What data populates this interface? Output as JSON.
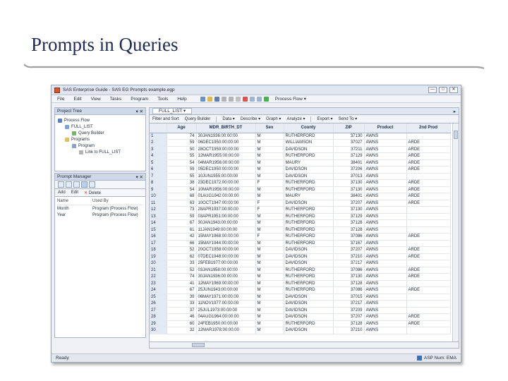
{
  "slide": {
    "title": "Prompts in Queries"
  },
  "window": {
    "title": "SAS Enterprise Guide - SAS EG Prompts example.egp",
    "buttons": [
      "—",
      "□",
      "✕"
    ]
  },
  "menu": [
    "File",
    "Edit",
    "View",
    "Tasks",
    "Program",
    "Tools",
    "Help"
  ],
  "toolbar": {
    "process_flow": "Process Flow ▾"
  },
  "project_tree": {
    "header": "Project Tree",
    "close": "▾ ✕",
    "items": [
      "Process Flow",
      "FULL_LIST",
      "Query Builder",
      "Programs",
      "Program",
      "Link to FULL_LIST"
    ]
  },
  "prompt_manager": {
    "header": "Prompt Manager",
    "close": "▾ ✕",
    "actions": [
      "Add",
      "Edit",
      "Delete"
    ],
    "columns": [
      "Name",
      "Used By"
    ],
    "rows": [
      {
        "name": "Month",
        "used_by": "Program (Process Flow)"
      },
      {
        "name": "Year",
        "used_by": "Program (Process Flow)"
      }
    ]
  },
  "data_view": {
    "tab": "FULL_LIST ▾",
    "tools": [
      "Filter and Sort",
      "Query Builder",
      "Data ▾",
      "Describe ▾",
      "Graph ▾",
      "Analyze ▾",
      "Export ▾",
      "Send To ▾"
    ],
    "columns": [
      "Age",
      "MDR_BIRTH_DT",
      "Sex",
      "County",
      "ZIP",
      "Product",
      "2nd Prod"
    ],
    "rows": [
      [
        "1",
        "74",
        "30JAN1936:00:00:00",
        "M",
        "RUTHERFORD",
        "37130",
        "AWNS",
        ""
      ],
      [
        "2",
        "59",
        "06DEC1950:00:00:00",
        "M",
        "WILLIAMSON",
        "37027",
        "AWNS",
        "ARDE"
      ],
      [
        "3",
        "50",
        "28OCT1959:00:00:00",
        "M",
        "DAVIDSON",
        "37211",
        "AWNS",
        "ARDE"
      ],
      [
        "4",
        "55",
        "12MAR1955:00:00:00",
        "M",
        "RUTHERFORD",
        "37129",
        "AWNS",
        "ARDE"
      ],
      [
        "5",
        "54",
        "04MAR1956:00:00:00",
        "M",
        "MAURY",
        "38401",
        "AWNS",
        "ARDE"
      ],
      [
        "6",
        "59",
        "05DEC1950:00:00:00",
        "M",
        "DAVIDSON",
        "37206",
        "AWNS",
        "ARDE"
      ],
      [
        "7",
        "55",
        "10JUN1955:00:00:00",
        "M",
        "DAVIDSON",
        "37013",
        "AWNS",
        ""
      ],
      [
        "8",
        "38",
        "23DEC1972:00:00:00",
        "F",
        "RUTHERFORD",
        "37130",
        "AWNS",
        "ARDE"
      ],
      [
        "9",
        "54",
        "10MAR1956:00:00:00",
        "M",
        "RUTHERFORD",
        "37130",
        "AWNS",
        "ARDE"
      ],
      [
        "10",
        "68",
        "01AUG1942:00:00:00",
        "M",
        "MAURY",
        "38401",
        "AWNS",
        "ARDE"
      ],
      [
        "11",
        "63",
        "10OCT1947:00:00:00",
        "F",
        "DAVIDSON",
        "37207",
        "AWNS",
        "ARDE"
      ],
      [
        "12",
        "73",
        "28APR1937:00:00:00",
        "F",
        "RUTHERFORD",
        "37130",
        "AWNS",
        ""
      ],
      [
        "13",
        "59",
        "03APR1951:00:00:00",
        "M",
        "RUTHERFORD",
        "37129",
        "AWNS",
        ""
      ],
      [
        "14",
        "67",
        "30JAN1943:00:00:00",
        "M",
        "RUTHERFORD",
        "37128",
        "AWNS",
        ""
      ],
      [
        "15",
        "61",
        "11JAN1949:00:00:00",
        "M",
        "RUTHERFORD",
        "37128",
        "AWNS",
        ""
      ],
      [
        "16",
        "42",
        "15MAY1968:00:00:00",
        "F",
        "RUTHERFORD",
        "37086",
        "AWNS",
        "ARDE"
      ],
      [
        "17",
        "66",
        "15MAY1944:00:00:00",
        "M",
        "RUTHERFORD",
        "37167",
        "AWNS",
        ""
      ],
      [
        "18",
        "52",
        "20OCT1958:00:00:00",
        "M",
        "DAVIDSON",
        "37207",
        "AWNS",
        "ARDE"
      ],
      [
        "19",
        "62",
        "07DEC1948:00:00:00",
        "M",
        "DAVIDSON",
        "37210",
        "AWNS",
        "ARDE"
      ],
      [
        "20",
        "33",
        "25FEB1977:00:00:00",
        "M",
        "DAVIDSON",
        "37217",
        "AWNS",
        ""
      ],
      [
        "21",
        "52",
        "03JAN1958:00:00:00",
        "M",
        "RUTHERFORD",
        "37086",
        "AWNS",
        "ARDE"
      ],
      [
        "22",
        "74",
        "30JAN1936:00:00:00",
        "M",
        "RUTHERFORD",
        "37130",
        "AWNS",
        "ARDE"
      ],
      [
        "23",
        "41",
        "12MAY1969:00:00:00",
        "M",
        "RUTHERFORD",
        "37128",
        "AWNS",
        ""
      ],
      [
        "24",
        "67",
        "25JUN1943:00:00:00",
        "M",
        "RUTHERFORD",
        "37086",
        "AWNS",
        "ARDE"
      ],
      [
        "25",
        "39",
        "06MAY1971:00:00:00",
        "M",
        "DAVIDSON",
        "37015",
        "AWNS",
        ""
      ],
      [
        "26",
        "33",
        "11NOV1977:00:00:00",
        "M",
        "DAVIDSON",
        "37217",
        "AWNS",
        ""
      ],
      [
        "27",
        "37",
        "25JUL1973:00:00:00",
        "M",
        "DAVIDSON",
        "37209",
        "AWNS",
        ""
      ],
      [
        "28",
        "46",
        "04AUG1964:00:00:00",
        "M",
        "DAVIDSON",
        "37207",
        "AWNS",
        "ARDE"
      ],
      [
        "29",
        "60",
        "24FEB1950:00:00:00",
        "M",
        "RUTHERFORD",
        "37128",
        "AWNS",
        "ARDE"
      ],
      [
        "30",
        "32",
        "12MAR1978:00:00:00",
        "M",
        "DAVIDSON",
        "37210",
        "AWNS",
        ""
      ]
    ]
  },
  "status": {
    "left": "Ready",
    "right": "ASP Num: EMA"
  },
  "colors": {
    "title": "#1f2a55",
    "rule": "#8c8c8c",
    "header_bg": "#e8edf5"
  }
}
